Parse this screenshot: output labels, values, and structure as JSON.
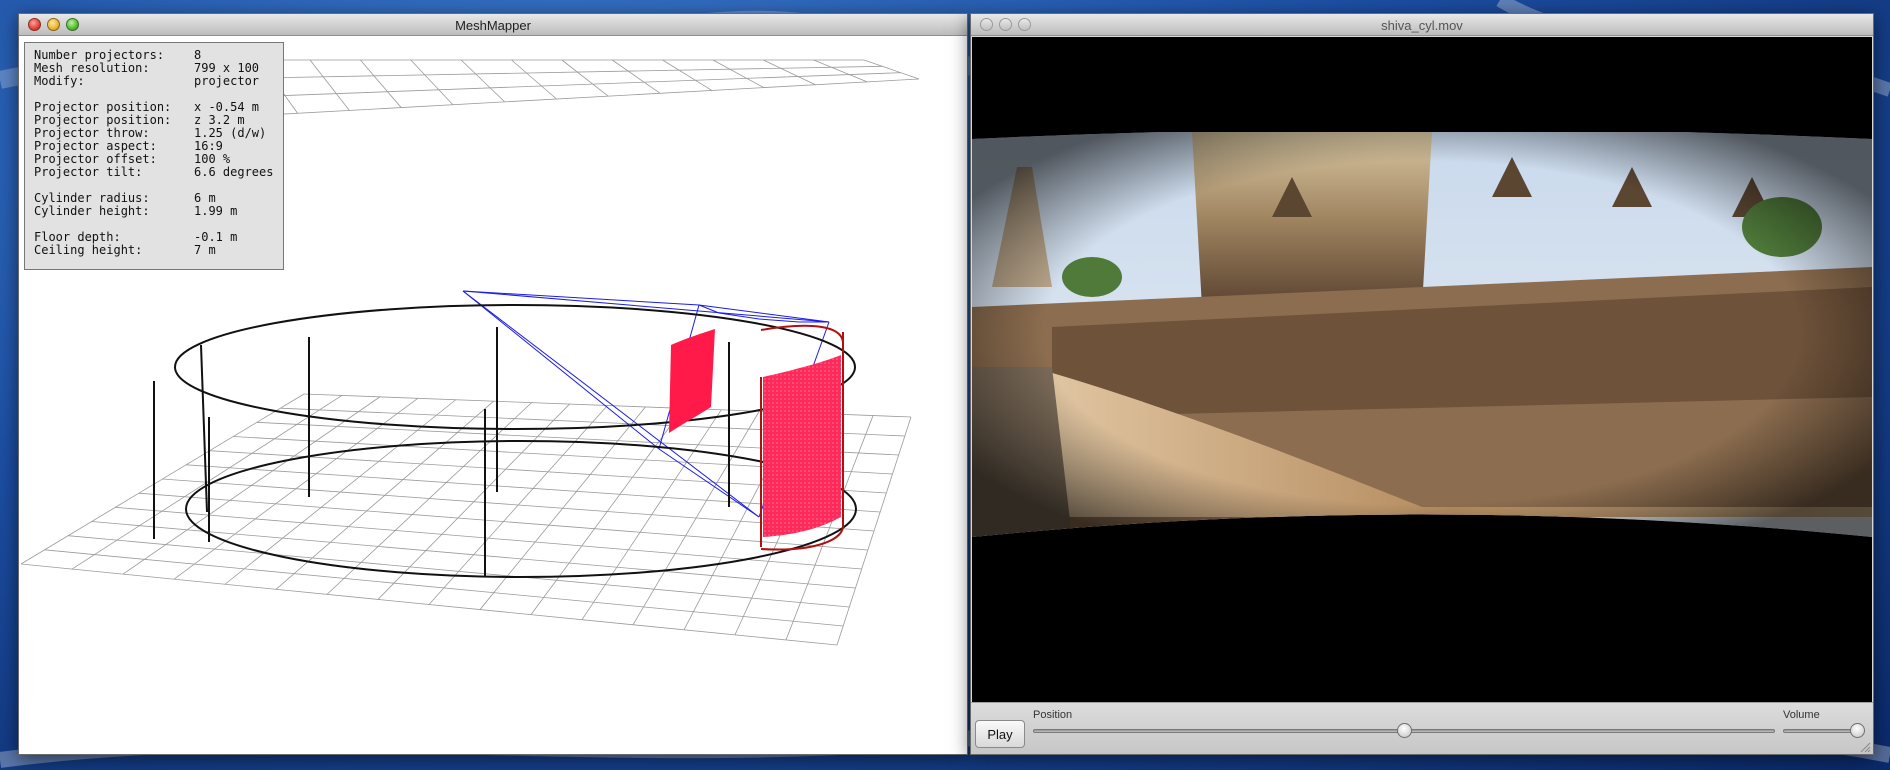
{
  "mesh_window": {
    "title": "MeshMapper",
    "info": {
      "number_projectors": {
        "label": "Number projectors:",
        "value": "8"
      },
      "mesh_resolution": {
        "label": "Mesh resolution:",
        "value": "799 x 100"
      },
      "modify": {
        "label": "Modify:",
        "value": "projector"
      },
      "projector_position_x": {
        "label": "Projector position:",
        "value": "x -0.54 m"
      },
      "projector_position_z": {
        "label": "Projector position:",
        "value": "z 3.2 m"
      },
      "projector_throw": {
        "label": "Projector throw:",
        "value": "1.25 (d/w)"
      },
      "projector_aspect": {
        "label": "Projector aspect:",
        "value": "16:9"
      },
      "projector_offset": {
        "label": "Projector offset:",
        "value": "100 %"
      },
      "projector_tilt": {
        "label": "Projector tilt:",
        "value": "6.6 degrees"
      },
      "cylinder_radius": {
        "label": "Cylinder radius:",
        "value": "6 m"
      },
      "cylinder_height": {
        "label": "Cylinder height:",
        "value": "1.99 m"
      },
      "floor_depth": {
        "label": "Floor depth:",
        "value": "-0.1 m"
      },
      "ceiling_height": {
        "label": "Ceiling height:",
        "value": "7 m"
      }
    }
  },
  "movie_window": {
    "title": "shiva_cyl.mov",
    "play_label": "Play",
    "position_label": "Position",
    "volume_label": "Volume",
    "position_fraction": 0.5,
    "volume_fraction": 1.0
  },
  "colors": {
    "grid": "#9a9a9a",
    "cylinder": "#111111",
    "frustum": "#1c1ce6",
    "surface": "#ff1a4a",
    "selection": "#b01010"
  }
}
